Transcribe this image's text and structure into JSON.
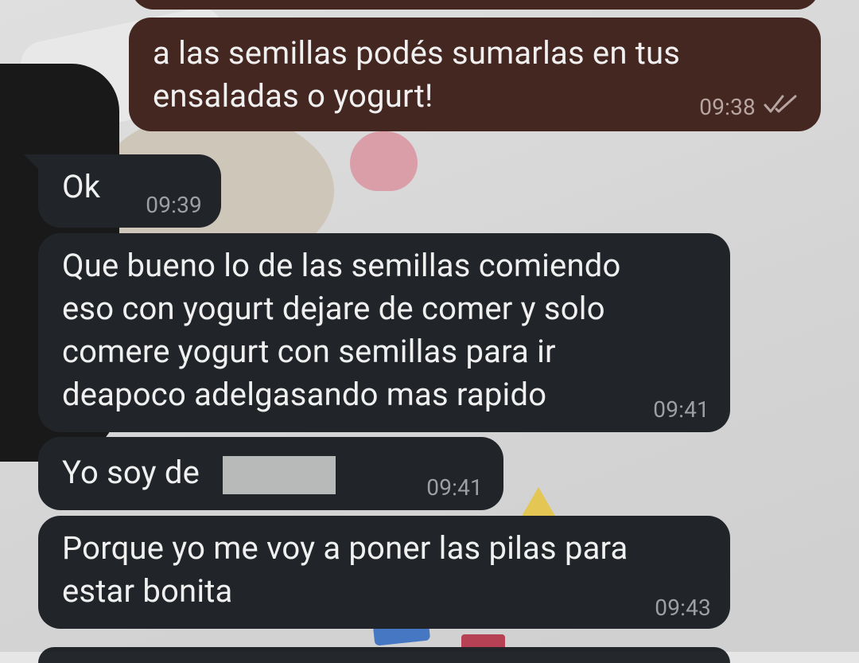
{
  "messages": [
    {
      "direction": "outgoing",
      "text": "a las semillas podés sumarlas en tus\nensaladas o yogurt!",
      "time": "09:38",
      "status": "read-double-check-icon"
    },
    {
      "direction": "incoming",
      "text": "Ok",
      "time": "09:39"
    },
    {
      "direction": "incoming",
      "text": "Que bueno lo de las semillas comiendo\neso con yogurt dejare de comer y solo\ncomere yogurt con semillas para ir\ndeapoco adelgasando mas rapido",
      "time": "09:41"
    },
    {
      "direction": "incoming",
      "text": "Yo soy de",
      "time": "09:41",
      "redacted": true
    },
    {
      "direction": "incoming",
      "text": "Porque yo me voy a poner las pilas para\nestar bonita",
      "time": "09:43"
    }
  ],
  "colors": {
    "outgoing_bubble": "#4a2a24",
    "incoming_bubble": "#24282c",
    "text": "#ffffff",
    "timestamp": "#a7aaad",
    "redaction": "#c4c6c6"
  }
}
